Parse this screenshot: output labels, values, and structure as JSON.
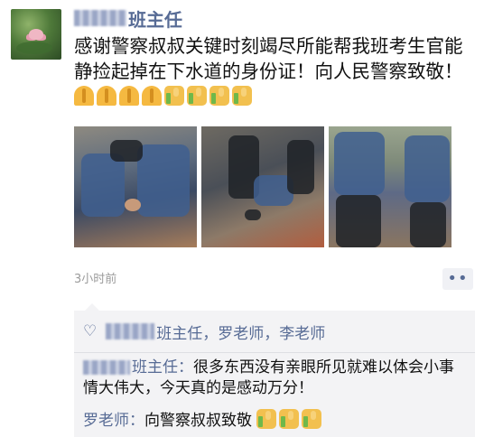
{
  "post": {
    "author_suffix": "班主任",
    "text": "感谢警察叔叔关键时刻竭尽所能帮我班考生官能静捡起掉在下水道的身份证！向人民警察致敬！",
    "emoji_reactions": [
      "pray-emoji",
      "pray-emoji",
      "pray-emoji",
      "pray-emoji",
      "thumbs-up-emoji",
      "thumbs-up-emoji",
      "thumbs-up-emoji",
      "thumbs-up-emoji"
    ],
    "photos": [
      "police-photo-1",
      "police-photo-2",
      "police-photo-3"
    ],
    "time": "3小时前"
  },
  "interaction": {
    "likes": {
      "heart_icon": "heart-icon",
      "names": [
        "班主任",
        "罗老师",
        "李老师"
      ],
      "separator": "，"
    },
    "comments": [
      {
        "author": "班主任",
        "colon": "：",
        "text": "很多东西没有亲眼所见就难以体会小事情大伟大，今天真的是感动万分！"
      },
      {
        "author": "罗老师",
        "colon": "：",
        "text": "向警察叔叔致敬",
        "emoji": [
          "thumbs-up-emoji",
          "thumbs-up-emoji",
          "thumbs-up-emoji"
        ]
      }
    ]
  },
  "colors": {
    "link": "#576b95",
    "text": "#111111",
    "timestamp": "#9b9b9b",
    "comment_bg": "#f3f3f5"
  }
}
